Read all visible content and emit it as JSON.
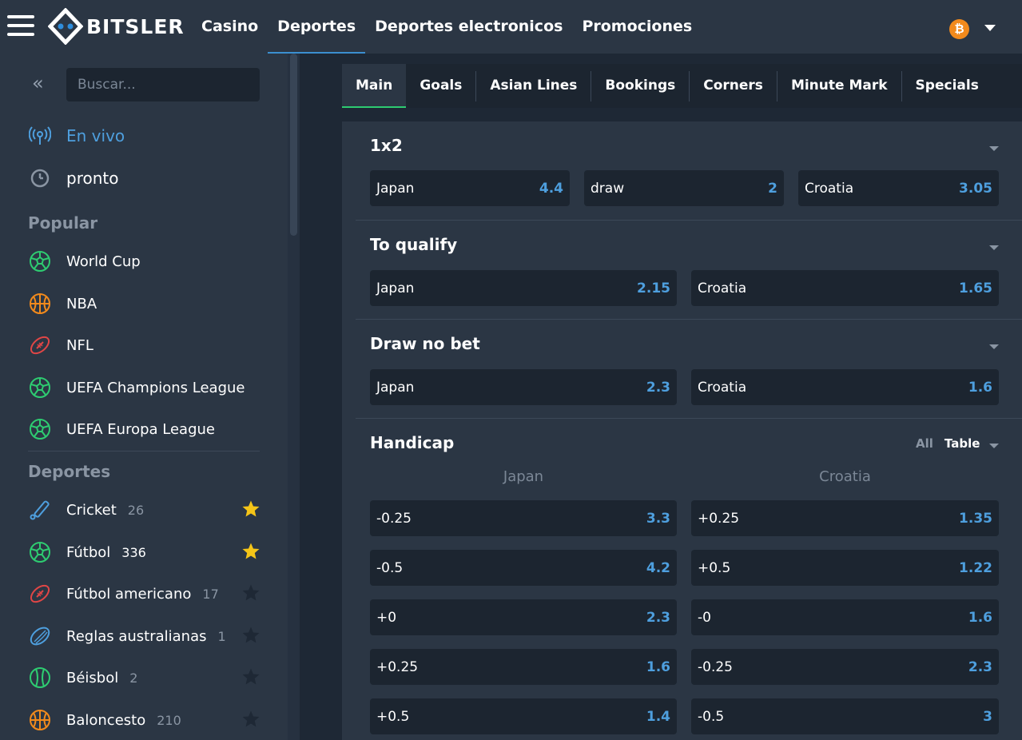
{
  "brand": {
    "name": "BITSLER"
  },
  "topnav": [
    "Casino",
    "Deportes",
    "Deportes electronicos",
    "Promociones"
  ],
  "topnav_active": "Deportes",
  "currency_icon": "bitcoin-icon",
  "sidebar": {
    "search_placeholder": "Buscar...",
    "live_label": "En vivo",
    "soon_label": "pronto",
    "popular_heading": "Popular",
    "popular": [
      {
        "label": "World Cup",
        "icon": "soccer-ball-icon"
      },
      {
        "label": "NBA",
        "icon": "basketball-icon"
      },
      {
        "label": "NFL",
        "icon": "american-football-icon"
      },
      {
        "label": "UEFA Champions League",
        "icon": "soccer-ball-icon"
      },
      {
        "label": "UEFA Europa League",
        "icon": "soccer-ball-icon"
      }
    ],
    "sports_heading": "Deportes",
    "sports": [
      {
        "label": "Cricket",
        "count": "26",
        "favorite": true,
        "icon": "cricket-icon"
      },
      {
        "label": "Fútbol",
        "count": "336",
        "favorite": true,
        "icon": "soccer-ball-icon"
      },
      {
        "label": "Fútbol americano",
        "count": "17",
        "favorite": false,
        "icon": "american-football-icon"
      },
      {
        "label": "Reglas australianas",
        "count": "1",
        "favorite": false,
        "icon": "aussie-rules-icon"
      },
      {
        "label": "Béisbol",
        "count": "2",
        "favorite": false,
        "icon": "baseball-icon"
      },
      {
        "label": "Baloncesto",
        "count": "210",
        "favorite": false,
        "icon": "basketball-icon"
      }
    ]
  },
  "tabs": [
    "Main",
    "Goals",
    "Asian Lines",
    "Bookings",
    "Corners",
    "Minute Mark",
    "Specials"
  ],
  "tabs_active": "Main",
  "markets": {
    "m1x2": {
      "title": "1x2",
      "outcomes": [
        {
          "name": "Japan",
          "odds": "4.4"
        },
        {
          "name": "draw",
          "odds": "2"
        },
        {
          "name": "Croatia",
          "odds": "3.05"
        }
      ]
    },
    "qualify": {
      "title": "To qualify",
      "outcomes": [
        {
          "name": "Japan",
          "odds": "2.15"
        },
        {
          "name": "Croatia",
          "odds": "1.65"
        }
      ]
    },
    "dnb": {
      "title": "Draw no bet",
      "outcomes": [
        {
          "name": "Japan",
          "odds": "2.3"
        },
        {
          "name": "Croatia",
          "odds": "1.6"
        }
      ]
    },
    "handicap": {
      "title": "Handicap",
      "view_all": "All",
      "view_table": "Table",
      "columns": [
        "Japan",
        "Croatia"
      ],
      "rows": [
        {
          "home": {
            "line": "-0.25",
            "odds": "3.3"
          },
          "away": {
            "line": "+0.25",
            "odds": "1.35"
          }
        },
        {
          "home": {
            "line": "-0.5",
            "odds": "4.2"
          },
          "away": {
            "line": "+0.5",
            "odds": "1.22"
          }
        },
        {
          "home": {
            "line": "+0",
            "odds": "2.3"
          },
          "away": {
            "line": "-0",
            "odds": "1.6"
          }
        },
        {
          "home": {
            "line": "+0.25",
            "odds": "1.6"
          },
          "away": {
            "line": "-0.25",
            "odds": "2.3"
          }
        },
        {
          "home": {
            "line": "+0.5",
            "odds": "1.4"
          },
          "away": {
            "line": "-0.5",
            "odds": "3"
          }
        }
      ]
    }
  },
  "colors": {
    "accent_blue": "#4e9fde",
    "tab_active_underline": "#2ecc71",
    "star_favorite": "#f5c518",
    "bitcoin": "#f28a1c"
  }
}
